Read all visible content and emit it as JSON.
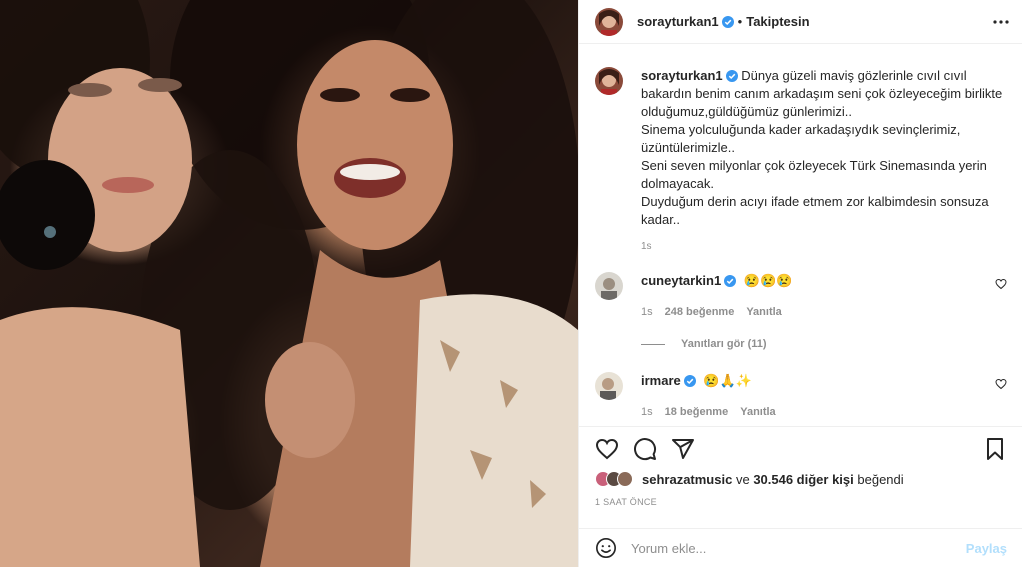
{
  "post": {
    "author": "sorayturkan1",
    "follow_status": "Takiptesin",
    "separator": "•",
    "caption": "Dünya güzeli maviş gözlerinle cıvıl cıvıl bakardın benim canım arkadaşım seni çok özleyeceğim birlikte olduğumuz,güldüğümüz günlerimizi..\nSinema yolculuğunda kader arkadaşıydık sevinçlerimiz, üzüntülerimizle..\nSeni seven milyonlar çok özleyecek Türk Sinemasında yerin dolmayacak.\nDuyduğum derin acıyı ifade etmem zor kalbimdesin sonsuza kadar..",
    "caption_time": "1s"
  },
  "comments": [
    {
      "user": "cuneytarkin1",
      "text": "😢😢😢",
      "time": "1s",
      "likes": "248 beğenme",
      "reply": "Yanıtla",
      "view_replies": "Yanıtları gör (11)"
    },
    {
      "user": "irmare",
      "text": "😢🙏✨",
      "time": "1s",
      "likes": "18 beğenme",
      "reply": "Yanıtla"
    }
  ],
  "likes_line": {
    "first_liker": "sehrazatmusic",
    "connector": "ve",
    "others": "30.546 diğer kişi",
    "suffix": "beğendi"
  },
  "time_ago": "1 SAAT ÖNCE",
  "add_comment": {
    "placeholder": "Yorum ekle...",
    "share_label": "Paylaş"
  },
  "icons": {
    "verified": "verified-badge-icon",
    "more": "more-options-icon",
    "like": "heart-icon",
    "comment": "comment-icon",
    "share": "share-icon",
    "save": "bookmark-icon",
    "emoji": "emoji-icon"
  },
  "colors": {
    "verified_blue": "#3897f0",
    "text": "#262626",
    "muted": "#8e8e8e",
    "share_disabled": "#b2dffc"
  }
}
